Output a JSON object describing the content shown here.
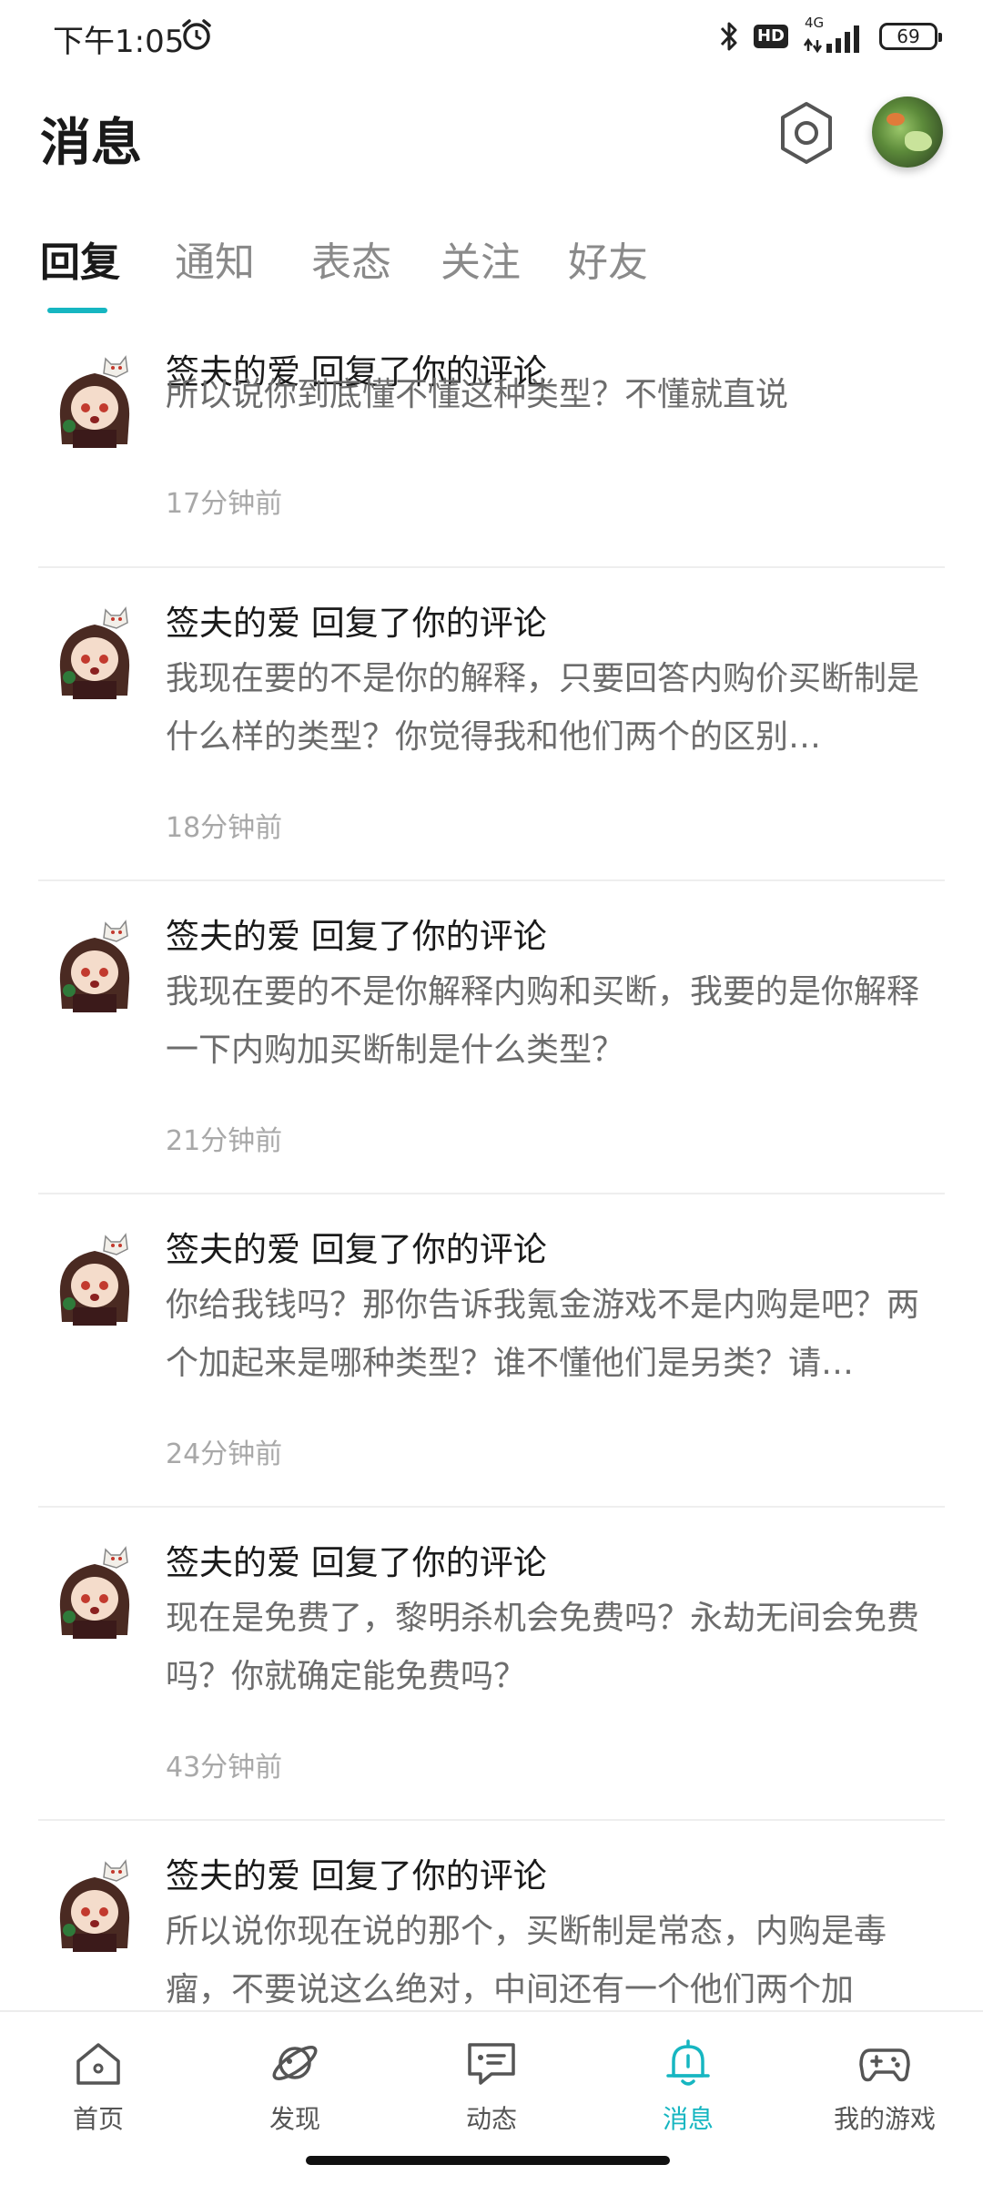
{
  "status_bar": {
    "time": "下午1:05",
    "hd": "HD",
    "network": "4G",
    "battery": "69"
  },
  "header": {
    "title": "消息"
  },
  "tabs": [
    {
      "label": "回复",
      "active": true
    },
    {
      "label": "通知",
      "active": false
    },
    {
      "label": "表态",
      "active": false
    },
    {
      "label": "关注",
      "active": false
    },
    {
      "label": "好友",
      "active": false
    }
  ],
  "messages": [
    {
      "title": "签夫的爱 回复了你的评论",
      "body": "所以说你到底懂不懂这种类型？不懂就直说",
      "time": "17分钟前"
    },
    {
      "title": "签夫的爱 回复了你的评论",
      "body": "我现在要的不是你的解释，只要回答内购价买断制是什么样的类型？你觉得我和他们两个的区别…",
      "time": "18分钟前"
    },
    {
      "title": "签夫的爱 回复了你的评论",
      "body": "我现在要的不是你解释内购和买断，我要的是你解释一下内购加买断制是什么类型？",
      "time": "21分钟前"
    },
    {
      "title": "签夫的爱 回复了你的评论",
      "body": "你给我钱吗？那你告诉我氪金游戏不是内购是吧？两个加起来是哪种类型？谁不懂他们是另类？请…",
      "time": "24分钟前"
    },
    {
      "title": "签夫的爱 回复了你的评论",
      "body": "现在是免费了，黎明杀机会免费吗？永劫无间会免费吗？你就确定能免费吗？",
      "time": "43分钟前"
    },
    {
      "title": "签夫的爱 回复了你的评论",
      "body": "所以说你现在说的那个，买断制是常态，内购是毒瘤，不要说这么绝对，中间还有一个他们两个加",
      "time": ""
    }
  ],
  "bottom_nav": [
    {
      "label": "首页",
      "icon": "home-icon"
    },
    {
      "label": "发现",
      "icon": "discover-planet-icon"
    },
    {
      "label": "动态",
      "icon": "feed-chat-icon"
    },
    {
      "label": "消息",
      "icon": "bell-icon",
      "active": true
    },
    {
      "label": "我的游戏",
      "icon": "gamepad-icon"
    }
  ],
  "colors": {
    "accent": "#16b6c1"
  }
}
